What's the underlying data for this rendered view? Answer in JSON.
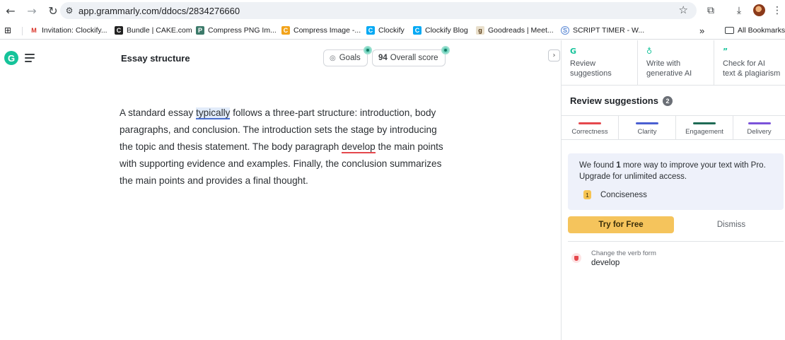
{
  "browser": {
    "url": "app.grammarly.com/ddocs/2834276660",
    "bookmarks": [
      {
        "label": "Invitation: Clockify...",
        "color": "#d93025",
        "glyph": "M"
      },
      {
        "label": "Bundle | CAKE.com",
        "color": "#222222",
        "glyph": "C"
      },
      {
        "label": "Compress PNG Im...",
        "color": "#3c7a6a",
        "glyph": "P"
      },
      {
        "label": "Compress Image -...",
        "color": "#f2a31b",
        "glyph": "C"
      },
      {
        "label": "Clockify",
        "color": "#03a9f4",
        "glyph": "C"
      },
      {
        "label": "Clockify Blog",
        "color": "#03a9f4",
        "glyph": "C"
      },
      {
        "label": "Goodreads | Meet...",
        "color": "#d8cbb0",
        "glyph": "g"
      },
      {
        "label": "SCRIPT TIMER - W...",
        "color": "#5e8bd6",
        "glyph": "S"
      }
    ],
    "overflow": "»",
    "all_bookmarks": "All Bookmarks"
  },
  "editor": {
    "doc_title": "Essay structure",
    "goals_label": "Goals",
    "score_value": "94",
    "score_label": "Overall score",
    "paragraph": {
      "pre": "A standard essay ",
      "highlight": "typically",
      "mid": " follows a three-part structure: introduction, body paragraphs, and conclusion. The introduction sets the stage by introducing the topic and thesis statement. The body paragraph ",
      "error": "develop",
      "post": " the main points with supporting evidence and examples. Finally, the conclusion summarizes the main points and provides a final thought."
    }
  },
  "panel": {
    "tabs": [
      {
        "line1": "Review",
        "line2": "suggestions"
      },
      {
        "line1": "Write with",
        "line2": "generative AI"
      },
      {
        "line1": "Check for AI",
        "line2": "text & plagiarism"
      }
    ],
    "review_title": "Review suggestions",
    "review_count": "2",
    "categories": [
      {
        "label": "Correctness",
        "color": "#e5484d"
      },
      {
        "label": "Clarity",
        "color": "#4a5fd1"
      },
      {
        "label": "Engagement",
        "color": "#1f6b55"
      },
      {
        "label": "Delivery",
        "color": "#7b52d9"
      }
    ],
    "pro": {
      "text_pre": "We found ",
      "count": "1",
      "text_post": " more way to improve your text with Pro. Upgrade for unlimited access.",
      "item_num": "1",
      "item_label": "Conciseness"
    },
    "try_label": "Try for Free",
    "dismiss_label": "Dismiss",
    "suggestion": {
      "hint": "Change the verb form",
      "word": "develop"
    }
  }
}
